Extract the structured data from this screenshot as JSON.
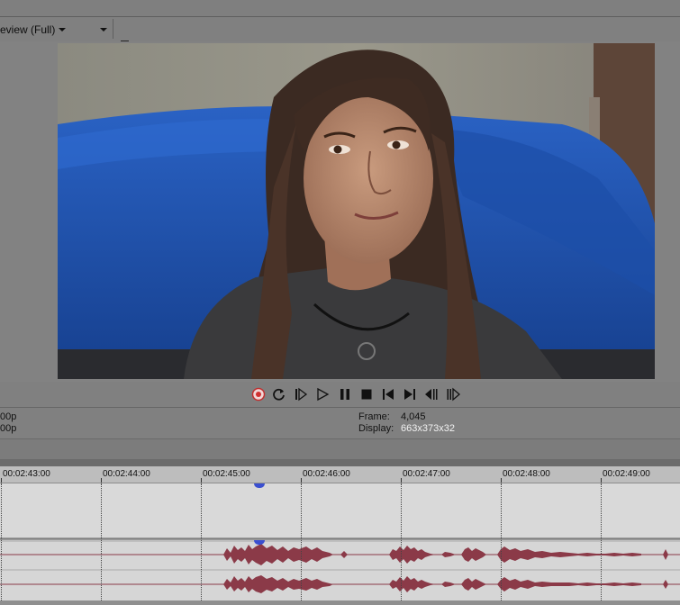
{
  "toolbar": {
    "preview_quality": "eview (Full)",
    "icons": [
      "dropdown-arrow-icon",
      "grid-overlay-icon",
      "dropdown-arrow-icon",
      "copy-snapshot-icon",
      "save-snapshot-icon"
    ]
  },
  "preview": {
    "description": "video preview frame"
  },
  "transport": {
    "buttons": [
      "record-icon",
      "loop-icon",
      "play-from-start-icon",
      "play-icon",
      "pause-icon",
      "stop-icon",
      "go-to-start-icon",
      "go-to-end-icon",
      "previous-frame-icon",
      "next-frame-icon"
    ]
  },
  "info": {
    "left_line1": "00p",
    "left_line2": "00p",
    "frame_label": "Frame:",
    "frame_value": "4,045",
    "display_label": "Display:",
    "display_value": "663x373x32"
  },
  "timeline": {
    "ruler_labels": [
      "00:02:43:00",
      "00:02:44:00",
      "00:02:45:00",
      "00:02:46:00",
      "00:02:47:00",
      "00:02:48:00",
      "00:02:49:00"
    ]
  },
  "colors": {
    "waveform": "#8b3a48",
    "record": "#d03030",
    "marker": "#3a4fd0",
    "bed": "#1e4fa6"
  }
}
